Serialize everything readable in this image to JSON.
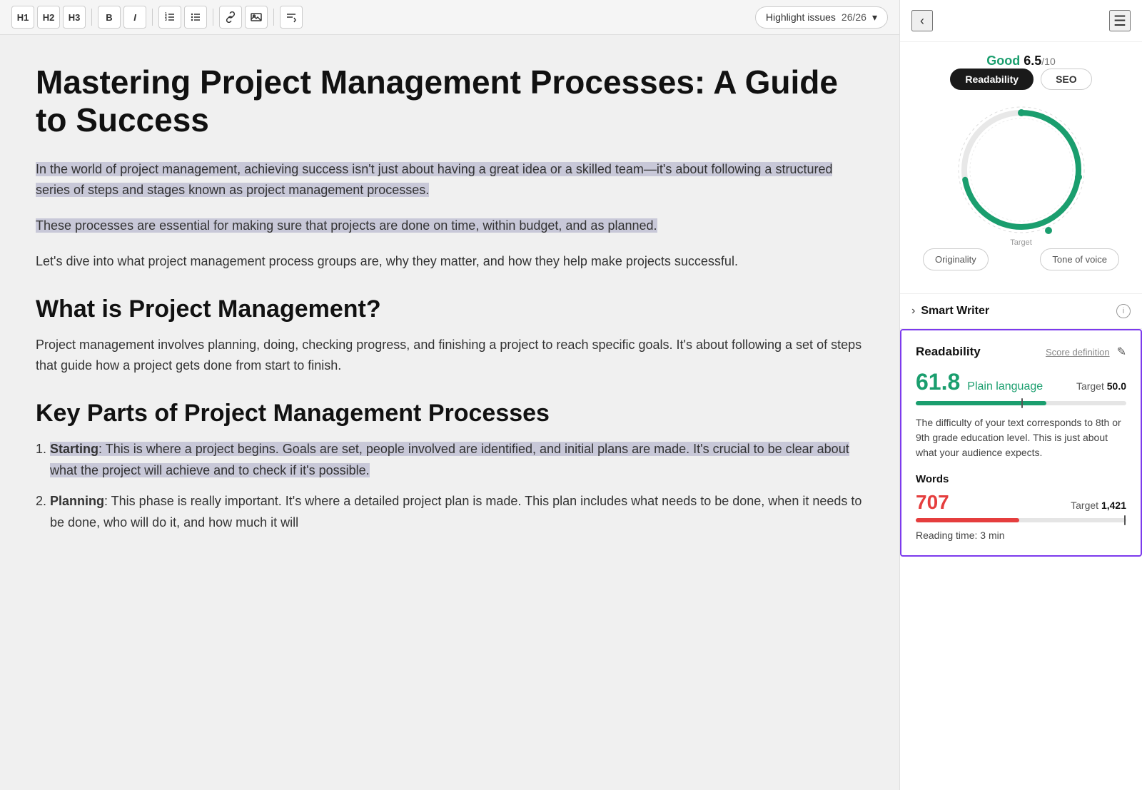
{
  "toolbar": {
    "h1_label": "H1",
    "h2_label": "H2",
    "h3_label": "H3",
    "bold_label": "B",
    "italic_label": "I",
    "highlight_issues_label": "Highlight issues",
    "issue_count": "26/26"
  },
  "editor": {
    "title": "Mastering Project Management Processes: A Guide to Success",
    "paragraphs": [
      "In the world of project management, achieving success isn't just about having a great idea or a skilled team—it's about following a structured series of steps and stages known as project management processes.",
      "These processes are essential for making sure that projects are done on time, within budget, and as planned.",
      "Let's dive into what project management process groups are, why they matter, and how they help make projects successful."
    ],
    "h2_1": "What is Project Management?",
    "p_pm": "Project management involves planning, doing, checking progress, and finishing a project to reach specific goals. It's about following a set of steps that guide how a project gets done from start to finish.",
    "h2_2": "Key Parts of Project Management Processes",
    "list_items": [
      {
        "number": "1",
        "bold": "Starting",
        "text": ": This is where a project begins. Goals are set, people involved are identified, and initial plans are made. It's crucial to be clear about what the project will achieve and to check if it's possible."
      },
      {
        "number": "2",
        "bold": "Planning",
        "text": ": This phase is really important. It's where a detailed project plan is made. This plan includes what needs to be done, when it needs to be done, who will do it, and how much it will"
      }
    ]
  },
  "sidebar": {
    "score_label": "Good ",
    "score_value": "6.5",
    "score_denom": "/10",
    "tabs": [
      {
        "label": "Readability",
        "active": true
      },
      {
        "label": "SEO",
        "active": false
      }
    ],
    "gauge": {
      "target_label": "Target"
    },
    "metric_buttons": [
      {
        "label": "Originality"
      },
      {
        "label": "Tone of voice"
      }
    ],
    "smart_writer": {
      "label": "Smart Writer"
    },
    "readability": {
      "title": "Readability",
      "score_def_label": "Score definition",
      "score": "61.8",
      "level": "Plain language",
      "target_label": "Target ",
      "target_value": "50.0",
      "progress_fill_pct": 62,
      "target_marker_pct": 50,
      "description": "The difficulty of your text corresponds to 8th or 9th grade education level. This is just about what your audience expects.",
      "words_title": "Words",
      "words_count": "707",
      "words_target_label": "Target ",
      "words_target_value": "1,421",
      "words_fill_pct": 49,
      "words_target_marker_pct": 100,
      "reading_time": "Reading time: 3 min"
    }
  }
}
